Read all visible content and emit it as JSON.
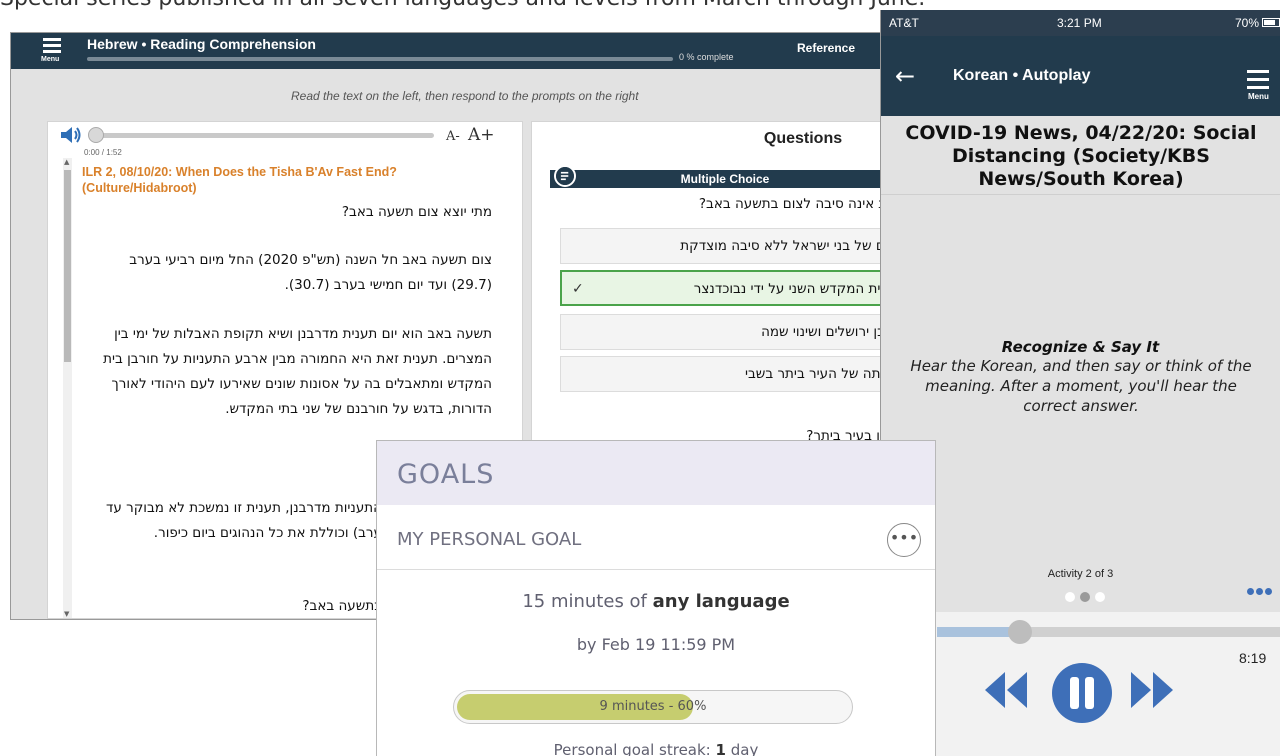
{
  "caption": "Special series published in all seven languages and levels from March through June.",
  "desktop": {
    "menu_label": "Menu",
    "title": "Hebrew • Reading Comprehension",
    "progress_text": "0 % complete",
    "progress_fraction": 0,
    "reference_label": "Reference",
    "instruction": "Read the text on the left, then respond to the prompts on the right",
    "audio": {
      "time": "0:00 / 1:52",
      "font_smaller": "A-",
      "font_larger": "A+"
    },
    "article_title": "ILR 2, 08/10/20: When Does the Tisha B'Av Fast End? (Culture/Hidabroot)",
    "paragraphs": [
      "מתי יוצא צום תשעה באב?",
      "צום תשעה באב חל השנה (תש\"פ 2020) החל מיום רביעי בערב (29.7) ועד יום חמישי בערב (30.7).",
      "תשעה באב הוא יום תענית מדרבנן ושיא תקופת האבלות של ימי בין המצרים. תענית זאת היא החמורה מבין ארבע התעניות על חורבן בית המקדש ומתאבלים בה על אסונות שונים שאירעו לעם היהודי לאורך הדורות, בדגש על חורבנם של שני בתי המקדש.",
      "התעניות מדרבנן, תענית זו נמשכת לא מבוקר עד ערב) וכוללת את כל הנהוגים ביום כיפור.",
      "בתשעה באב?"
    ],
    "questions": {
      "title": "Questions",
      "type_label": "Multiple Choice",
      "prompt": "באות אינה סיבה לצום בתשעה באב?",
      "options": [
        "לותם של בני ישראל ללא סיבה מוצדקת",
        "בן בית המקדש השני על ידי נבוכדנצר",
        "חורבן ירושלים ושינוי שמה",
        "נפילתה של העיר ביתר בשבי"
      ],
      "selected_index": 1,
      "check_mark": "✓",
      "next_prompt": "ים חיו בעיר ביתר?"
    }
  },
  "goals": {
    "title": "GOALS",
    "subtitle": "MY PERSONAL GOAL",
    "more_icon": "•••",
    "goal_prefix": "15 minutes of",
    "goal_highlight": "any language",
    "deadline": "by Feb 19 11:59 PM",
    "bar_text": "9 minutes - 60%",
    "progress_fraction": 0.6,
    "streak_prefix": "Personal goal streak:",
    "streak_value": "1",
    "streak_suffix": "day"
  },
  "phone": {
    "status": {
      "carrier": "AT&T",
      "time": "3:21 PM",
      "battery": "70%"
    },
    "nav_title": "Korean • Autoplay",
    "menu_label": "Menu",
    "heading": "COVID-19 News, 04/22/20: Social Distancing (Society/KBS News/South Korea)",
    "mode_title": "Recognize & Say It",
    "instruction": "Hear the Korean, and then say or think of the meaning. After a moment, you'll hear the correct answer.",
    "activity": "Activity 2 of 3",
    "elapsed_fraction": 0.24,
    "time": "8:19",
    "accent": "#3e6fb8"
  }
}
